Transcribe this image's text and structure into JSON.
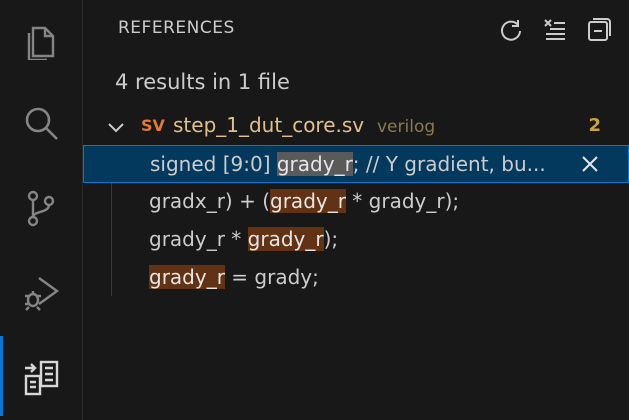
{
  "activity_bar": {
    "items": [
      {
        "icon": "files-icon"
      },
      {
        "icon": "search-icon"
      },
      {
        "icon": "source-control-icon"
      },
      {
        "icon": "run-debug-icon"
      },
      {
        "icon": "references-icon",
        "active": true
      }
    ]
  },
  "panel": {
    "title": "REFERENCES",
    "actions": [
      "refresh-icon",
      "clear-all-icon",
      "collapse-all-icon"
    ],
    "summary": "4 results in 1 file",
    "file": {
      "badge": "SV",
      "name": "step_1_dut_core.sv",
      "language": "verilog",
      "count": "2"
    },
    "results": [
      {
        "before": "signed [9:0] ",
        "match": "grady_r",
        "after": "; // Y gradient, bu...",
        "selected": true
      },
      {
        "before": "gradx_r) + (",
        "match": "grady_r",
        "after": " * grady_r);"
      },
      {
        "before": "grady_r * ",
        "match": "grady_r",
        "after": ");"
      },
      {
        "before": "",
        "match": "grady_r",
        "after": " = grady;"
      }
    ]
  },
  "colors": {
    "accent": "#0078d4",
    "selection": "#04395e",
    "match_highlight": "#613214",
    "file_name": "#e2c08d",
    "badge": "#e37933"
  }
}
